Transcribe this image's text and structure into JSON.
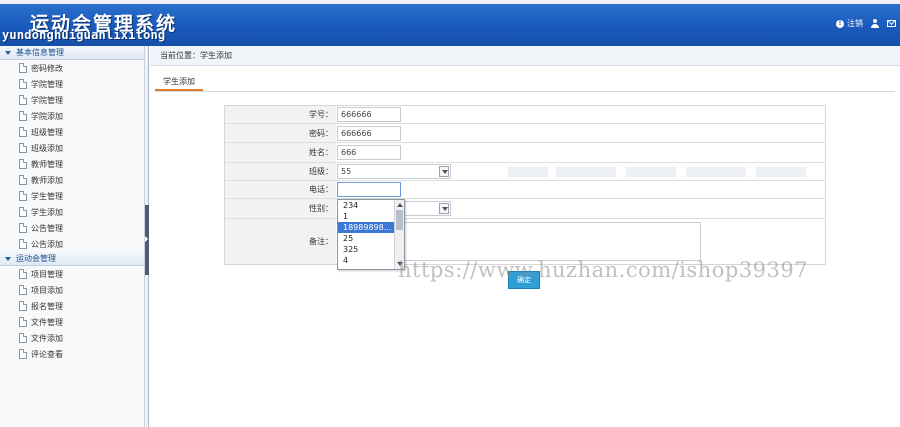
{
  "header": {
    "title": "运动会管理系统",
    "subtitle": "yundonghuiguanlixitong",
    "logout_label": "注销",
    "logout_icon": "info-circle-icon",
    "user_icon": "user-icon",
    "mail_icon": "mail-icon"
  },
  "sidebar": {
    "groups": [
      {
        "title": "基本信息管理",
        "items": [
          {
            "label": "密码修改"
          },
          {
            "label": "学院管理"
          },
          {
            "label": "学院管理"
          },
          {
            "label": "学院添加"
          },
          {
            "label": "班级管理"
          },
          {
            "label": "班级添加"
          },
          {
            "label": "教师管理"
          },
          {
            "label": "教师添加"
          },
          {
            "label": "学生管理"
          },
          {
            "label": "学生添加"
          },
          {
            "label": "公告管理"
          },
          {
            "label": "公告添加"
          }
        ]
      },
      {
        "title": "运动会管理",
        "items": [
          {
            "label": "项目管理"
          },
          {
            "label": "项目添加"
          },
          {
            "label": "报名管理"
          },
          {
            "label": "文件管理"
          },
          {
            "label": "文件添加"
          },
          {
            "label": "评论查看"
          }
        ]
      }
    ]
  },
  "breadcrumb": "当前位置：学生添加",
  "tab": {
    "label": "学生添加"
  },
  "form": {
    "student_id": {
      "label": "学号：",
      "value": "666666"
    },
    "password": {
      "label": "密码：",
      "value": "666666"
    },
    "name": {
      "label": "姓名：",
      "value": "666"
    },
    "class": {
      "label": "班级：",
      "value": "55"
    },
    "phone": {
      "label": "电话：",
      "value": ""
    },
    "gender": {
      "label": "性别：",
      "value": ""
    },
    "remark": {
      "label": "备注：",
      "value": ""
    },
    "submit_label": "确定"
  },
  "autocomplete": {
    "options": [
      "234",
      "1",
      "18989898...",
      "25",
      "325",
      "4"
    ],
    "selected_index": 2
  },
  "watermark": "https://www.huzhan.com/ishop39397",
  "colors": {
    "header_blue": "#1a5bbd",
    "tab_accent": "#e07a2e",
    "button_blue": "#2f9fd6",
    "selection_blue": "#3a78d4"
  }
}
